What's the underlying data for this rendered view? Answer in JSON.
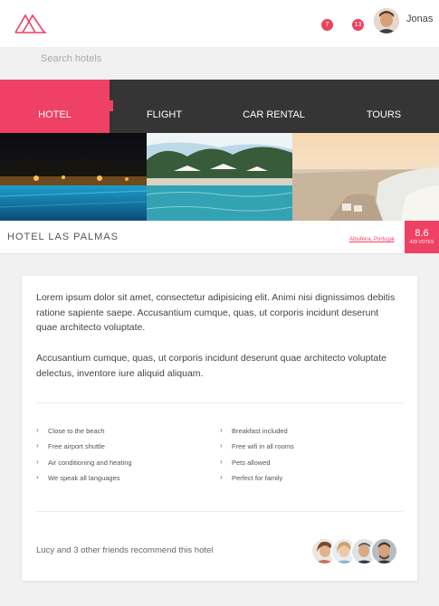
{
  "header": {
    "notifications": [
      {
        "count": "7"
      },
      {
        "count": "13"
      }
    ],
    "user_name": "Jonas"
  },
  "search": {
    "placeholder": "Search hotels"
  },
  "tabs": [
    {
      "label": "HOTEL",
      "active": true
    },
    {
      "label": "FLIGHT",
      "active": false
    },
    {
      "label": "CAR RENTAL",
      "active": false
    },
    {
      "label": "TOURS",
      "active": false
    }
  ],
  "hotel": {
    "name": "HOTEL LAS PALMAS",
    "location": "Albufeira, Portugal",
    "rating": "8.6",
    "votes": "429 VOTES"
  },
  "description": [
    "Lorem ipsum dolor sit amet, consectetur adipisicing elit. Animi nisi dignissimos debitis ratione sapiente saepe. Accusantium cumque, quas, ut corporis incidunt deserunt quae architecto voluptate.",
    "Accusantium cumque, quas, ut corporis incidunt deserunt quae architecto voluptate delectus, inventore iure aliquid aliquam."
  ],
  "amenities": [
    "Close to the beach",
    "Free airport shuttle",
    "Air conditioning and heating",
    "We speak all languages",
    "Breakfast included",
    "Free wifi in all rooms",
    "Pets allowed",
    "Perfect for family"
  ],
  "recommendation": "Lucy and 3 other friends recommend this hotel",
  "colors": {
    "accent": "#ef4163",
    "tab_bar": "#353535"
  },
  "icons": [
    "logo-icon",
    "chevron-right-icon"
  ]
}
